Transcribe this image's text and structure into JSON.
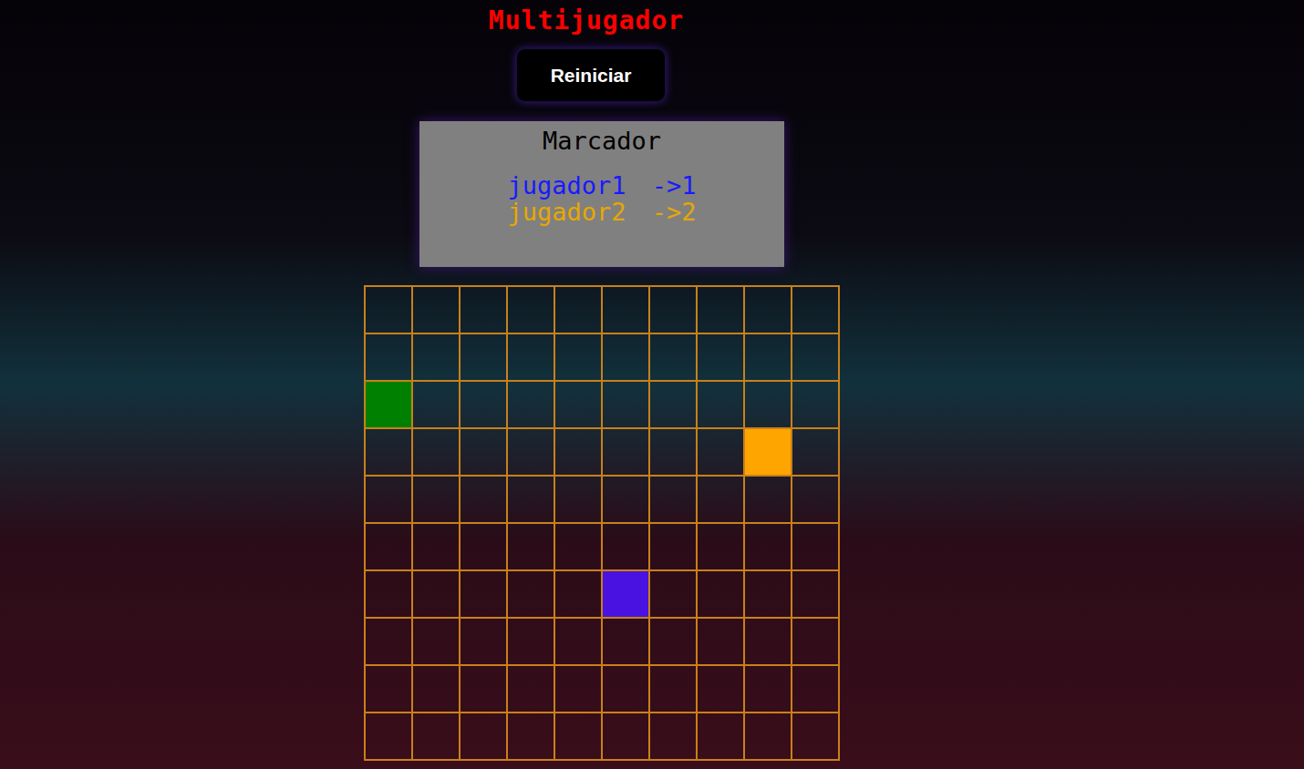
{
  "title": "Multijugador",
  "button": "Reiniciar",
  "scoreboard": {
    "title": "Marcador",
    "players": [
      {
        "name": "jugador1",
        "score": "->1",
        "color": "#1a1aff"
      },
      {
        "name": "jugador2",
        "score": "->2",
        "color": "#e6a800"
      }
    ]
  },
  "board": [
    [
      null,
      null,
      null,
      null,
      null,
      null,
      null,
      null,
      null,
      null
    ],
    [
      null,
      null,
      null,
      null,
      null,
      null,
      null,
      null,
      null,
      null
    ],
    [
      "#008000",
      null,
      null,
      null,
      null,
      null,
      null,
      null,
      null,
      null
    ],
    [
      null,
      null,
      null,
      null,
      null,
      null,
      null,
      null,
      "#ffa500",
      null
    ],
    [
      null,
      null,
      null,
      null,
      null,
      null,
      null,
      null,
      null,
      null
    ],
    [
      null,
      null,
      null,
      null,
      null,
      null,
      null,
      null,
      null,
      null
    ],
    [
      null,
      null,
      null,
      null,
      null,
      "#4a12e0",
      null,
      null,
      null,
      null
    ],
    [
      null,
      null,
      null,
      null,
      null,
      null,
      null,
      null,
      null,
      null
    ],
    [
      null,
      null,
      null,
      null,
      null,
      null,
      null,
      null,
      null,
      null
    ],
    [
      null,
      null,
      null,
      null,
      null,
      null,
      null,
      null,
      null,
      null
    ]
  ]
}
